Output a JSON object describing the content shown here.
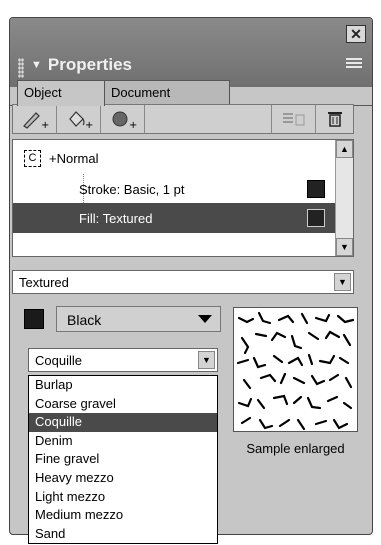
{
  "panel": {
    "title": "Properties"
  },
  "tabs": [
    {
      "label": "Object",
      "active": true
    },
    {
      "label": "Document",
      "active": false
    }
  ],
  "toolbar": {
    "buttons": [
      "add-stroke-icon",
      "add-fill-icon",
      "add-effect-icon",
      "delete-all-icon",
      "trash-icon"
    ]
  },
  "attributes": {
    "style": "+Normal",
    "rows": [
      {
        "label": "Stroke: Basic, 1 pt",
        "selected": false
      },
      {
        "label": "Fill: Textured",
        "selected": true
      }
    ]
  },
  "fill_type": {
    "value": "Textured"
  },
  "color": {
    "value": "Black",
    "swatch": "#1a1a1a"
  },
  "texture": {
    "value": "Coquille",
    "options": [
      "Burlap",
      "Coarse gravel",
      "Coquille",
      "Denim",
      "Fine gravel",
      "Heavy mezzo",
      "Light mezzo",
      "Medium mezzo",
      "Sand"
    ],
    "selected_index": 2
  },
  "preview": {
    "caption": "Sample enlarged"
  },
  "colors": {
    "selection": "#4a4a4a",
    "panel_bg": "#c6c6c6",
    "titlebar": "#7a7a7a"
  }
}
